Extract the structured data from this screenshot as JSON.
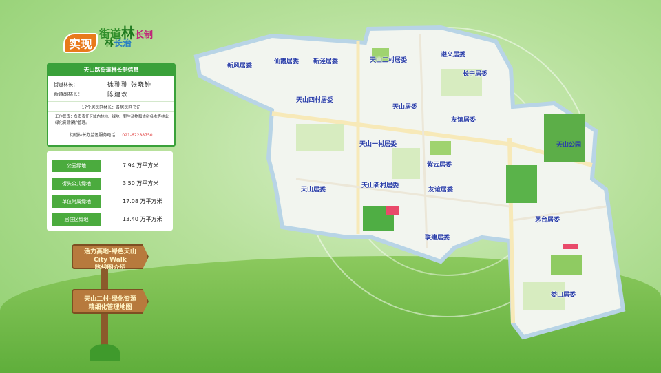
{
  "logo": {
    "line1_a": "街道",
    "line1_b": "林",
    "line1_c": "长制",
    "line2": "实现",
    "line3_a": "林",
    "line3_b": "长治"
  },
  "info": {
    "title": "天山路街道林长制信息",
    "chief_label": "街道林长：",
    "chief_value": "徐翀翀  张晓钟",
    "deputy_label": "街道副林长：",
    "deputy_value": "陈建欢",
    "district_note": "17个居民区林长：各居民区书记",
    "work_text": "工作职责：负责责任区域内林地、绿地、野生动物和古树名木等林业绿化资源保护管理。",
    "phone_label": "街道林长办监督服务电话：",
    "phone": "021-62288750"
  },
  "stats": [
    {
      "label": "公园绿地",
      "value": "7.94 万平方米"
    },
    {
      "label": "街头公共绿地",
      "value": "3.50 万平方米"
    },
    {
      "label": "单位附属绿地",
      "value": "17.08 万平方米"
    },
    {
      "label": "居住区绿地",
      "value": "13.40 万平方米"
    }
  ],
  "signs": [
    {
      "line1": "活力高地-绿色天山",
      "line2": "City  Walk",
      "line3": "路线图介绍"
    },
    {
      "line1": "天山二村-绿化资源",
      "line2": "精细化管理地图",
      "line3": ""
    }
  ],
  "districts": [
    "新风居委",
    "仙霞居委",
    "新泾居委",
    "天山二村居委",
    "遵义居委",
    "天山四村居委",
    "天山居委",
    "长宁居委",
    "友谊居委",
    "天山一村居委",
    "紫云居委",
    "天山居委",
    "天山新村居委",
    "友谊居委",
    "联建居委",
    "茅台居委",
    "娄山居委"
  ],
  "park": "天山公园",
  "colors": {
    "green": "#3aa13a",
    "label_blue": "#2b3fa8",
    "phone_red": "#e03a3a",
    "logo_orange": "#e87a1c"
  }
}
